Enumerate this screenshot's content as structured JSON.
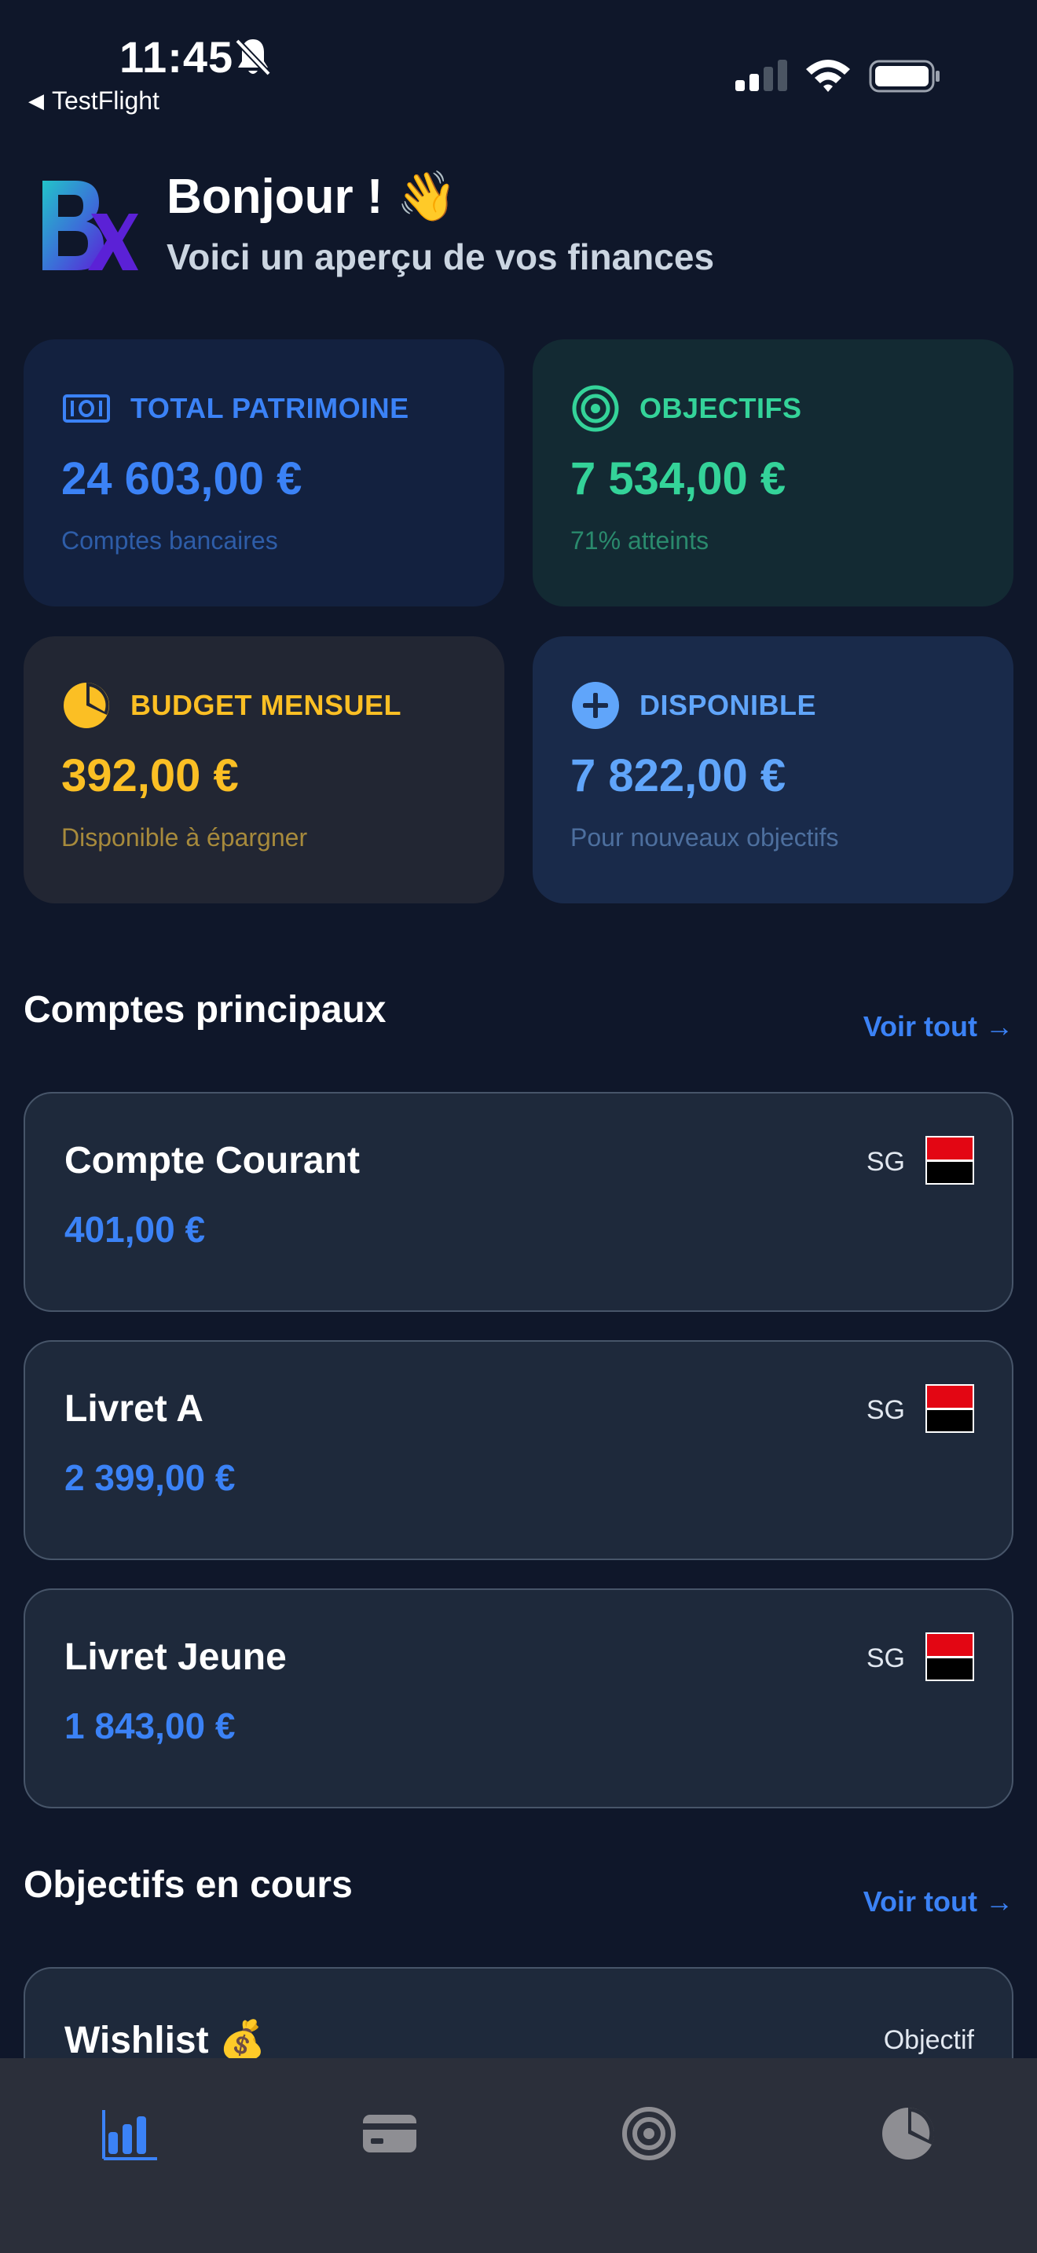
{
  "status_bar": {
    "time": "11:45",
    "back_app": "TestFlight"
  },
  "header": {
    "greeting": "Bonjour ! 👋",
    "subtitle": "Voici un aperçu de vos finances"
  },
  "stats": [
    {
      "label": "TOTAL PATRIMOINE",
      "value": "24 603,00 €",
      "sub": "Comptes bancaires",
      "icon": "banknote-icon",
      "color": "#3b82f6"
    },
    {
      "label": "OBJECTIFS",
      "value": "7 534,00 €",
      "sub": "71% atteints",
      "icon": "target-icon",
      "color": "#34d399"
    },
    {
      "label": "BUDGET MENSUEL",
      "value": "392,00 €",
      "sub": "Disponible à épargner",
      "icon": "pie-chart-icon",
      "color": "#fbbf24"
    },
    {
      "label": "DISPONIBLE",
      "value": "7 822,00 €",
      "sub": "Pour nouveaux objectifs",
      "icon": "plus-circle-icon",
      "color": "#60a5fa"
    }
  ],
  "accounts_section": {
    "title": "Comptes principaux",
    "see_all": "Voir tout →",
    "accounts": [
      {
        "name": "Compte Courant",
        "amount": "401,00 €",
        "bank": "SG"
      },
      {
        "name": "Livret A",
        "amount": "2 399,00 €",
        "bank": "SG"
      },
      {
        "name": "Livret Jeune",
        "amount": "1 843,00 €",
        "bank": "SG"
      }
    ]
  },
  "goals_section": {
    "title": "Objectifs en cours",
    "see_all": "Voir tout →",
    "goals": [
      {
        "name": "Wishlist 💰",
        "tag": "Objectif"
      }
    ]
  },
  "tab_bar": {
    "tabs": [
      {
        "icon": "bar-chart-icon",
        "active": true
      },
      {
        "icon": "credit-card-icon",
        "active": false
      },
      {
        "icon": "target-icon",
        "active": false
      },
      {
        "icon": "pie-chart-icon",
        "active": false
      }
    ],
    "active_color": "#3b82f6",
    "inactive_color": "#8e8e93"
  }
}
